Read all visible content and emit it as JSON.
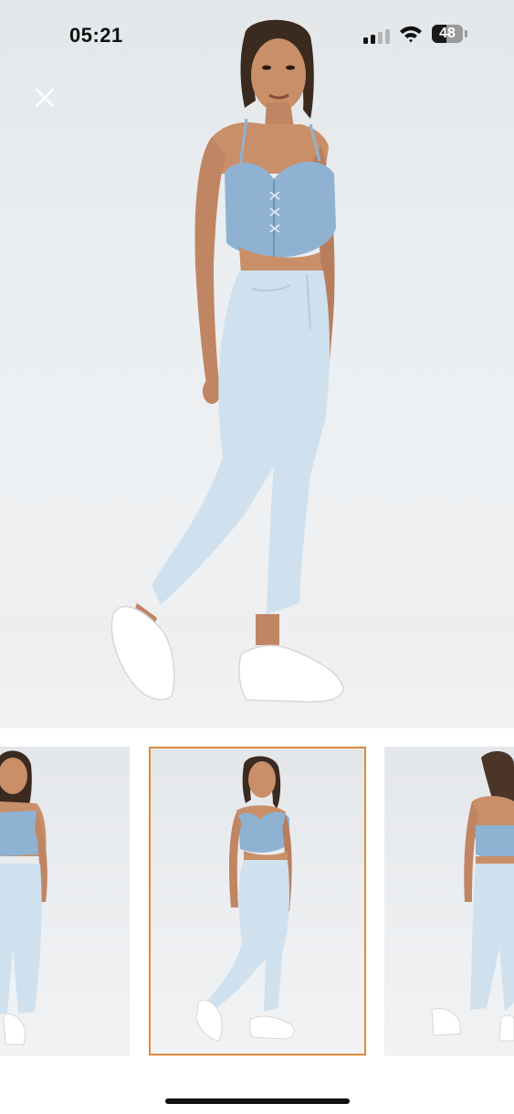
{
  "status_bar": {
    "time": "05:21",
    "battery_percent": "48",
    "battery_level": 0.48,
    "signal_bars": 4,
    "signal_bars_active": 2,
    "icons": [
      "cellular-signal-icon",
      "wifi-icon",
      "battery-icon"
    ]
  },
  "viewer": {
    "close_icon": "close-icon",
    "main_image": "model-denim-outfit-front-angle",
    "thumbnails": [
      {
        "image": "model-front-view",
        "selected": false
      },
      {
        "image": "model-side-walking-view",
        "selected": true
      },
      {
        "image": "model-back-view",
        "selected": false
      }
    ],
    "selected_border_color": "#e0893e"
  },
  "colors": {
    "denim_top": "#8fb2d2",
    "jeans": "#cfe1ee",
    "skin": "#c98f69",
    "hair": "#3a2a20",
    "sneakers": "#ffffff"
  }
}
